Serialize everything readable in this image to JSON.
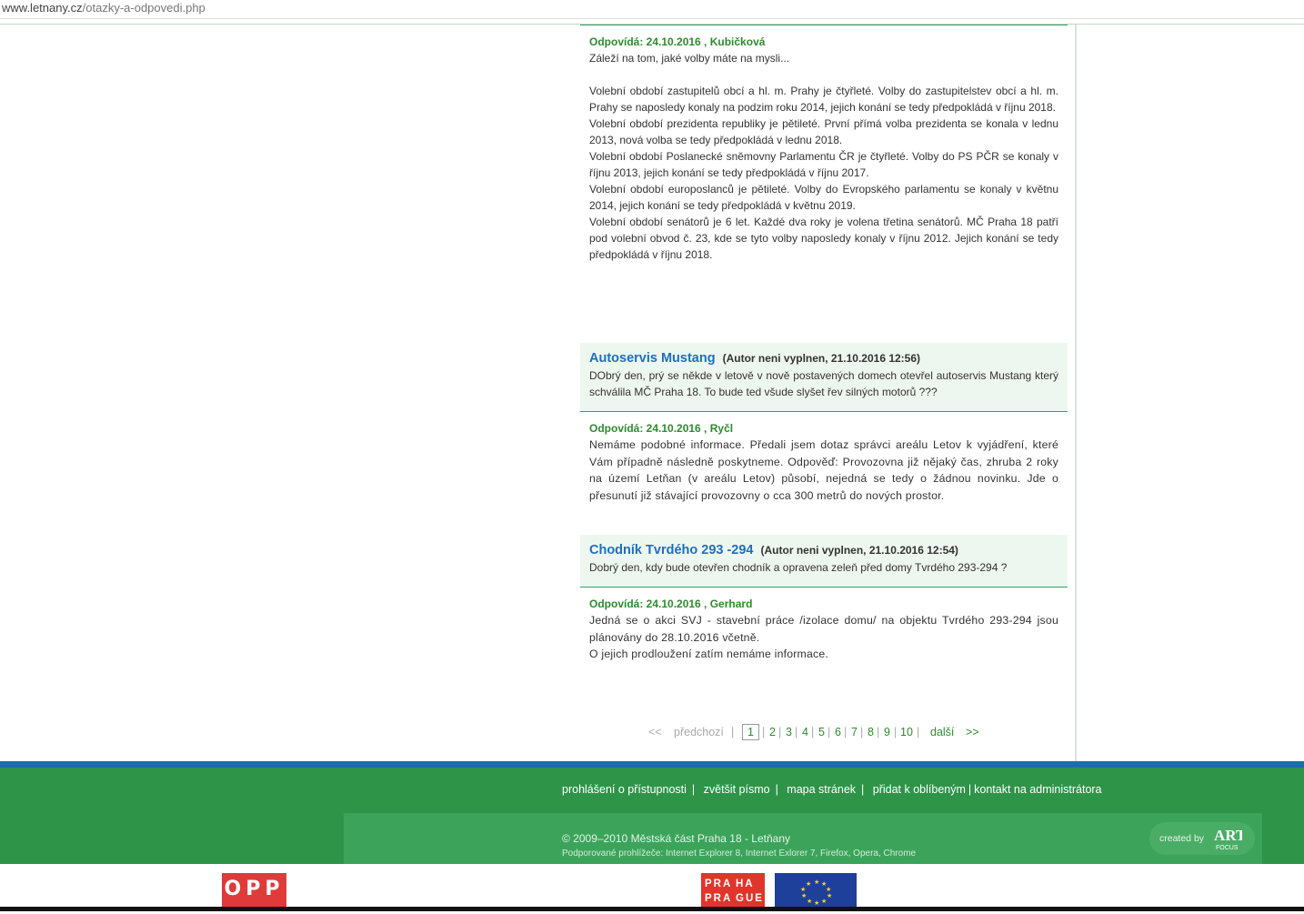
{
  "browser": {
    "url_host": "www.letnany.cz",
    "url_path": "/otazky-a-odpovedi.php"
  },
  "entries": [
    {
      "answer_head": "Odpovídá: 24.10.2016 , Kubičková",
      "answer_lines": [
        "Záleží na tom, jaké volby máte na mysli...",
        "",
        "Volební období zastupitelů obcí a hl. m. Prahy je čtyřleté. Volby do zastupitelstev obcí a hl. m. Prahy se naposledy konaly na podzim roku 2014, jejich konání se tedy předpokládá v říjnu 2018.",
        "Volební období prezidenta republiky je pětileté. První přímá volba prezidenta se konala v lednu 2013, nová volba se tedy předpokládá v lednu 2018.",
        "Volební období Poslanecké sněmovny Parlamentu ČR je čtyřleté. Volby do PS PČR se konaly v říjnu 2013, jejich konání se tedy předpokládá v říjnu 2017.",
        "Volební období europoslanců je pětileté. Volby do Evropského parlamentu se konaly v květnu 2014, jejich konání se tedy předpokládá v květnu 2019.",
        "Volební období senátorů je 6 let. Každé dva roky je volena třetina senátorů. MČ Praha 18 patří pod volební obvod č. 23, kde se tyto volby naposledy konaly v říjnu 2012. Jejich konání se tedy předpokládá v říjnu 2018."
      ]
    },
    {
      "question_title": "Autoservis Mustang",
      "question_meta": "(Autor neni vyplnen, 21.10.2016 12:56)",
      "question_text": "DObrý den, prý se někde v letově v nově postavených domech otevřel autoservis Mustang který schválila MČ Praha 18. To bude ted všude slyšet řev silných motorů ???",
      "answer_head": "Odpovídá: 24.10.2016 , Ryčl",
      "answer_text": "Nemáme podobné informace. Předali jsem dotaz správci areálu Letov k vyjádření, které Vám případně následně poskytneme. Odpověď: Provozovna již nějaký čas, zhruba 2 roky na území Letňan (v areálu Letov) působí, nejedná se tedy o žádnou novinku. Jde o přesunutí již stávající provozovny o cca 300 metrů do nových prostor."
    },
    {
      "question_title": "Chodník Tvrdého 293 -294",
      "question_meta": "(Autor neni vyplnen, 21.10.2016 12:54)",
      "question_text": "Dobrý den, kdy bude otevřen chodník a opravena zeleň před domy Tvrdého 293-294 ?",
      "answer_head": "Odpovídá: 24.10.2016 , Gerhard",
      "answer_lines": [
        "Jedná se o  akci SVJ - stavební práce /izolace domu/ na objektu Tvrdého 293-294 jsou plánovány do 28.10.2016 včetně.",
        "O jejich prodloužení zatím nemáme informace."
      ]
    }
  ],
  "pagination": {
    "first": "<<",
    "prev": "předchozí",
    "pages": [
      "1",
      "2",
      "3",
      "4",
      "5",
      "6",
      "7",
      "8",
      "9",
      "10"
    ],
    "current": "1",
    "next": "další",
    "last": ">>"
  },
  "footer": {
    "links": [
      "prohlášení o přístupnosti",
      "zvětšit písmo",
      "mapa stránek",
      "přidat k oblíbeným",
      "kontakt na administrátora"
    ],
    "copyright": "© 2009–2010 Městská část Praha 18 - Letňany",
    "browsers": "Podporované prohlížeče: Internet Explorer 8, Internet Exlorer 7, Firefox, Opera, Chrome",
    "created_by": "created by",
    "created_logo_text": "ART FOCUS"
  },
  "logos": {
    "opp": "OPP",
    "praha_lines": [
      "PRA",
      "HA",
      "PRA",
      "GUE"
    ],
    "eu": "EU flag"
  },
  "colors": {
    "link_blue": "#1e6fc2",
    "answer_green": "#2e8b2e",
    "footer_green": "#2e9448",
    "footer_blue": "#1b6bb0"
  }
}
